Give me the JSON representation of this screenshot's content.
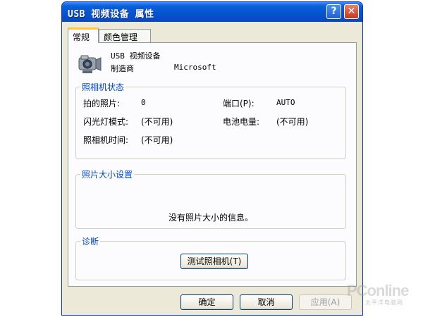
{
  "window": {
    "title": "USB 视频设备 属性",
    "help_glyph": "?",
    "close_glyph": "✕"
  },
  "tabs": [
    {
      "label": "常规",
      "active": true
    },
    {
      "label": "颜色管理",
      "active": false
    }
  ],
  "device": {
    "icon": "camera-icon",
    "name": "USB 视频设备",
    "manufacturer_label": "制造商",
    "manufacturer_value": "Microsoft"
  },
  "camera_status": {
    "title": "照相机状态",
    "photos_taken_label": "拍的照片:",
    "photos_taken_value": "0",
    "port_label": "端口(P):",
    "port_value": "AUTO",
    "flash_label": "闪光灯模式:",
    "flash_value": "(不可用)",
    "battery_label": "电池电量:",
    "battery_value": "(不可用)",
    "time_label": "照相机时间:",
    "time_value": "(不可用)"
  },
  "photo_size": {
    "title": "照片大小设置",
    "message": "没有照片大小的信息。"
  },
  "diagnostics": {
    "title": "诊断",
    "test_button": "测试照相机(T)"
  },
  "footer": {
    "ok": "确定",
    "cancel": "取消",
    "apply": "应用(A)"
  },
  "watermark": {
    "brand": "PConline",
    "sub": "太平洋电脑网"
  },
  "colors": {
    "titlebar": "#0653d0",
    "group_title": "#0046d5",
    "dialog_bg": "#ece9d8"
  }
}
